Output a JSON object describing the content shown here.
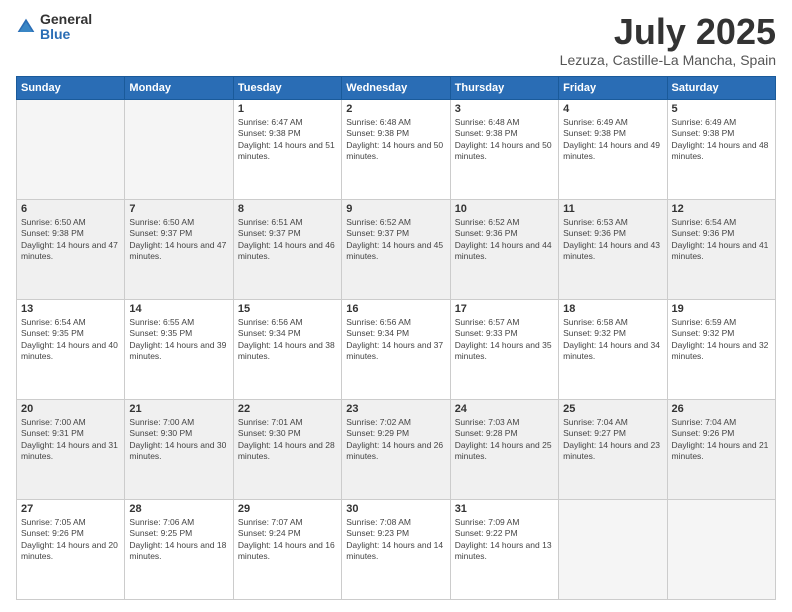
{
  "logo": {
    "general": "General",
    "blue": "Blue"
  },
  "title": "July 2025",
  "location": "Lezuza, Castille-La Mancha, Spain",
  "days_header": [
    "Sunday",
    "Monday",
    "Tuesday",
    "Wednesday",
    "Thursday",
    "Friday",
    "Saturday"
  ],
  "weeks": [
    {
      "shaded": false,
      "days": [
        {
          "num": "",
          "info": ""
        },
        {
          "num": "",
          "info": ""
        },
        {
          "num": "1",
          "info": "Sunrise: 6:47 AM\nSunset: 9:38 PM\nDaylight: 14 hours and 51 minutes."
        },
        {
          "num": "2",
          "info": "Sunrise: 6:48 AM\nSunset: 9:38 PM\nDaylight: 14 hours and 50 minutes."
        },
        {
          "num": "3",
          "info": "Sunrise: 6:48 AM\nSunset: 9:38 PM\nDaylight: 14 hours and 50 minutes."
        },
        {
          "num": "4",
          "info": "Sunrise: 6:49 AM\nSunset: 9:38 PM\nDaylight: 14 hours and 49 minutes."
        },
        {
          "num": "5",
          "info": "Sunrise: 6:49 AM\nSunset: 9:38 PM\nDaylight: 14 hours and 48 minutes."
        }
      ]
    },
    {
      "shaded": true,
      "days": [
        {
          "num": "6",
          "info": "Sunrise: 6:50 AM\nSunset: 9:38 PM\nDaylight: 14 hours and 47 minutes."
        },
        {
          "num": "7",
          "info": "Sunrise: 6:50 AM\nSunset: 9:37 PM\nDaylight: 14 hours and 47 minutes."
        },
        {
          "num": "8",
          "info": "Sunrise: 6:51 AM\nSunset: 9:37 PM\nDaylight: 14 hours and 46 minutes."
        },
        {
          "num": "9",
          "info": "Sunrise: 6:52 AM\nSunset: 9:37 PM\nDaylight: 14 hours and 45 minutes."
        },
        {
          "num": "10",
          "info": "Sunrise: 6:52 AM\nSunset: 9:36 PM\nDaylight: 14 hours and 44 minutes."
        },
        {
          "num": "11",
          "info": "Sunrise: 6:53 AM\nSunset: 9:36 PM\nDaylight: 14 hours and 43 minutes."
        },
        {
          "num": "12",
          "info": "Sunrise: 6:54 AM\nSunset: 9:36 PM\nDaylight: 14 hours and 41 minutes."
        }
      ]
    },
    {
      "shaded": false,
      "days": [
        {
          "num": "13",
          "info": "Sunrise: 6:54 AM\nSunset: 9:35 PM\nDaylight: 14 hours and 40 minutes."
        },
        {
          "num": "14",
          "info": "Sunrise: 6:55 AM\nSunset: 9:35 PM\nDaylight: 14 hours and 39 minutes."
        },
        {
          "num": "15",
          "info": "Sunrise: 6:56 AM\nSunset: 9:34 PM\nDaylight: 14 hours and 38 minutes."
        },
        {
          "num": "16",
          "info": "Sunrise: 6:56 AM\nSunset: 9:34 PM\nDaylight: 14 hours and 37 minutes."
        },
        {
          "num": "17",
          "info": "Sunrise: 6:57 AM\nSunset: 9:33 PM\nDaylight: 14 hours and 35 minutes."
        },
        {
          "num": "18",
          "info": "Sunrise: 6:58 AM\nSunset: 9:32 PM\nDaylight: 14 hours and 34 minutes."
        },
        {
          "num": "19",
          "info": "Sunrise: 6:59 AM\nSunset: 9:32 PM\nDaylight: 14 hours and 32 minutes."
        }
      ]
    },
    {
      "shaded": true,
      "days": [
        {
          "num": "20",
          "info": "Sunrise: 7:00 AM\nSunset: 9:31 PM\nDaylight: 14 hours and 31 minutes."
        },
        {
          "num": "21",
          "info": "Sunrise: 7:00 AM\nSunset: 9:30 PM\nDaylight: 14 hours and 30 minutes."
        },
        {
          "num": "22",
          "info": "Sunrise: 7:01 AM\nSunset: 9:30 PM\nDaylight: 14 hours and 28 minutes."
        },
        {
          "num": "23",
          "info": "Sunrise: 7:02 AM\nSunset: 9:29 PM\nDaylight: 14 hours and 26 minutes."
        },
        {
          "num": "24",
          "info": "Sunrise: 7:03 AM\nSunset: 9:28 PM\nDaylight: 14 hours and 25 minutes."
        },
        {
          "num": "25",
          "info": "Sunrise: 7:04 AM\nSunset: 9:27 PM\nDaylight: 14 hours and 23 minutes."
        },
        {
          "num": "26",
          "info": "Sunrise: 7:04 AM\nSunset: 9:26 PM\nDaylight: 14 hours and 21 minutes."
        }
      ]
    },
    {
      "shaded": false,
      "days": [
        {
          "num": "27",
          "info": "Sunrise: 7:05 AM\nSunset: 9:26 PM\nDaylight: 14 hours and 20 minutes."
        },
        {
          "num": "28",
          "info": "Sunrise: 7:06 AM\nSunset: 9:25 PM\nDaylight: 14 hours and 18 minutes."
        },
        {
          "num": "29",
          "info": "Sunrise: 7:07 AM\nSunset: 9:24 PM\nDaylight: 14 hours and 16 minutes."
        },
        {
          "num": "30",
          "info": "Sunrise: 7:08 AM\nSunset: 9:23 PM\nDaylight: 14 hours and 14 minutes."
        },
        {
          "num": "31",
          "info": "Sunrise: 7:09 AM\nSunset: 9:22 PM\nDaylight: 14 hours and 13 minutes."
        },
        {
          "num": "",
          "info": ""
        },
        {
          "num": "",
          "info": ""
        }
      ]
    }
  ]
}
